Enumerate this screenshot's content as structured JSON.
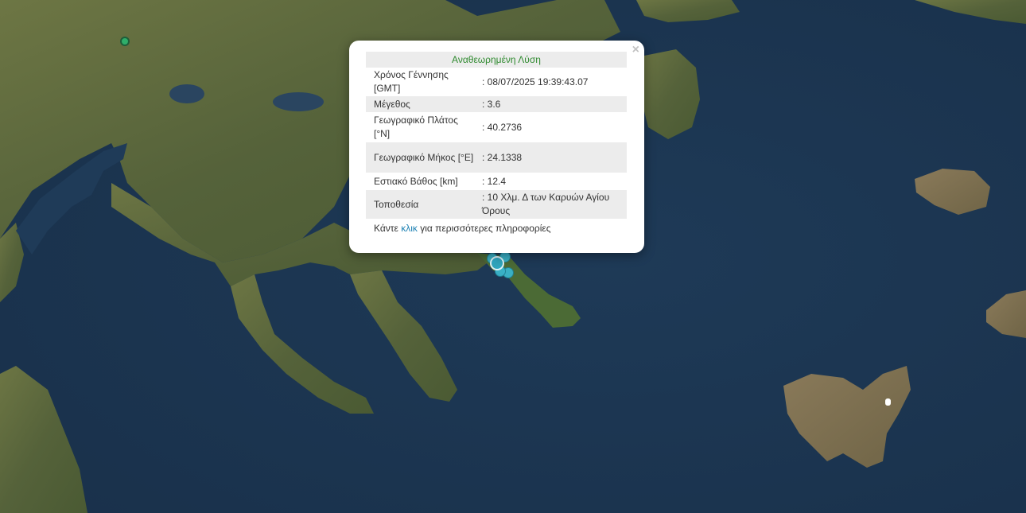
{
  "popup": {
    "title": "Αναθεωρημένη Λύση",
    "close_label": "×",
    "rows": [
      {
        "key": "Χρόνος Γέννησης [GMT]",
        "value": ": 08/07/2025 19:39:43.07"
      },
      {
        "key": "Μέγεθος",
        "value": ": 3.6"
      },
      {
        "key": "Γεωγραφικό Πλάτος [°N]",
        "value": ": 40.2736"
      },
      {
        "key": "Γεωγραφικό Μήκος [°E]",
        "value": ": 24.1338"
      },
      {
        "key": "Εστιακό Βάθος [km]",
        "value": ": 12.4"
      },
      {
        "key": "Τοποθεσία",
        "value": ": 10 Χλμ. Δ των Καρυών Αγίου Όρους"
      }
    ],
    "footer": {
      "prefix": "Κάντε ",
      "link": "κλικ",
      "suffix": " για περισσότερες πληροφορίες"
    }
  },
  "colors": {
    "sea": "#1d3550",
    "land": "#5e6a3c",
    "quake_marker": "#3ab4cc",
    "station_marker": "#2fae6a",
    "popup_title": "#2f8a2f",
    "link": "#1e82b4"
  },
  "markers": {
    "quake_icon": "circle-marker",
    "station_icon": "circle-marker"
  }
}
